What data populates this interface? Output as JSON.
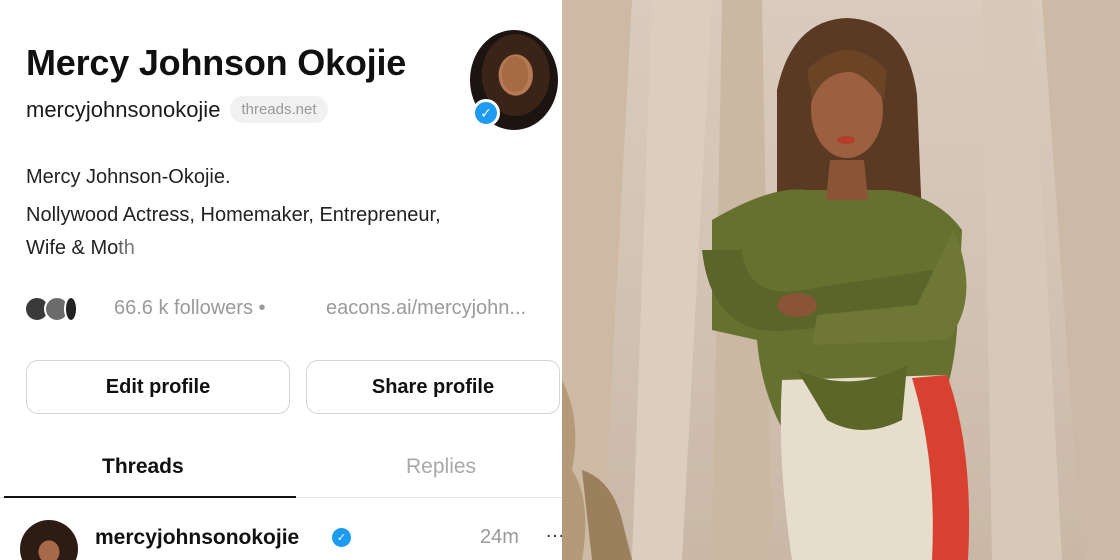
{
  "profile": {
    "name": "Mercy Johnson Okojie",
    "handle": "mercyjohnsonokojie",
    "domain_chip": "threads.net",
    "bio_line1": "Mercy Johnson-Okojie.",
    "bio_line2": "Nollywood Actress, Homemaker, Entrepreneur,",
    "bio_line3": "Wife & Moth",
    "followers": "66.6 k followers",
    "separator": "•",
    "link": "eacons.ai/mercyjohn..."
  },
  "actions": {
    "edit_label": "Edit profile",
    "share_label": "Share profile"
  },
  "tabs": {
    "threads": "Threads",
    "replies": "Replies"
  },
  "post": {
    "handle": "mercyjohnsonokojie",
    "time": "24m",
    "more": "…"
  },
  "icons": {
    "verified": "verified-badge-icon",
    "check_glyph": "✓"
  },
  "colors": {
    "verified_blue": "#1d9bf0",
    "muted_text": "#9a9a9a",
    "border": "#d5d5d5"
  }
}
